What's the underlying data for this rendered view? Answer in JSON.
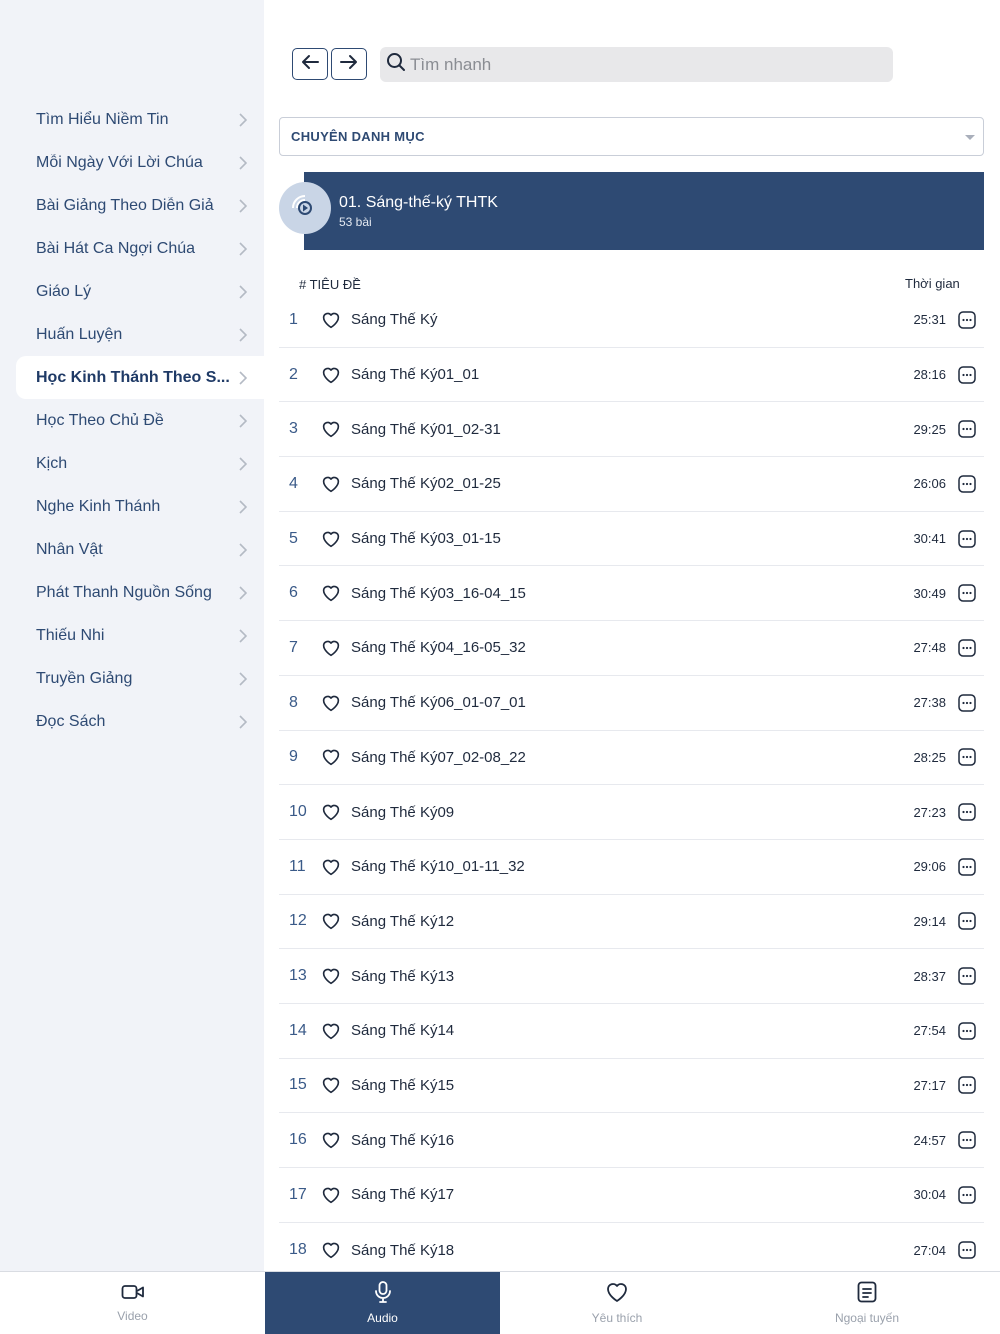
{
  "sidebar": {
    "items": [
      {
        "label": "Tìm Hiểu Niềm Tin",
        "active": false
      },
      {
        "label": "Mỗi Ngày Với Lời Chúa",
        "active": false
      },
      {
        "label": "Bài Giảng Theo Diễn Giả",
        "active": false
      },
      {
        "label": "Bài Hát Ca Ngợi Chúa",
        "active": false
      },
      {
        "label": "Giáo Lý",
        "active": false
      },
      {
        "label": "Huấn Luyện",
        "active": false
      },
      {
        "label": "Học Kinh Thánh Theo S...",
        "active": true
      },
      {
        "label": "Học Theo Chủ Đề",
        "active": false
      },
      {
        "label": "Kịch",
        "active": false
      },
      {
        "label": "Nghe Kinh Thánh",
        "active": false
      },
      {
        "label": "Nhân Vật",
        "active": false
      },
      {
        "label": "Phát Thanh Nguồn Sống",
        "active": false
      },
      {
        "label": "Thiếu Nhi",
        "active": false
      },
      {
        "label": "Truyền Giảng",
        "active": false
      },
      {
        "label": "Đọc Sách",
        "active": false
      }
    ]
  },
  "header": {
    "search_placeholder": "Tìm nhanh"
  },
  "category_select": {
    "label": "CHUYÊN DANH MỤC"
  },
  "playlist": {
    "title": "01. Sáng-thế-ký THTK",
    "count": "53 bài"
  },
  "columns": {
    "title": "# TIÊU ĐỀ",
    "duration": "Thời gian"
  },
  "tracks": [
    {
      "num": "1",
      "title": "Sáng Thế Ký",
      "duration": "25:31"
    },
    {
      "num": "2",
      "title": "Sáng Thế Ký01_01",
      "duration": "28:16"
    },
    {
      "num": "3",
      "title": "Sáng Thế Ký01_02-31",
      "duration": "29:25"
    },
    {
      "num": "4",
      "title": "Sáng Thế Ký02_01-25",
      "duration": "26:06"
    },
    {
      "num": "5",
      "title": "Sáng Thế Ký03_01-15",
      "duration": "30:41"
    },
    {
      "num": "6",
      "title": "Sáng Thế Ký03_16-04_15",
      "duration": "30:49"
    },
    {
      "num": "7",
      "title": "Sáng Thế Ký04_16-05_32",
      "duration": "27:48"
    },
    {
      "num": "8",
      "title": "Sáng Thế Ký06_01-07_01",
      "duration": "27:38"
    },
    {
      "num": "9",
      "title": "Sáng Thế Ký07_02-08_22",
      "duration": "28:25"
    },
    {
      "num": "10",
      "title": "Sáng Thế Ký09",
      "duration": "27:23"
    },
    {
      "num": "11",
      "title": "Sáng Thế Ký10_01-11_32",
      "duration": "29:06"
    },
    {
      "num": "12",
      "title": "Sáng Thế Ký12",
      "duration": "29:14"
    },
    {
      "num": "13",
      "title": "Sáng Thế Ký13",
      "duration": "28:37"
    },
    {
      "num": "14",
      "title": "Sáng Thế Ký14",
      "duration": "27:54"
    },
    {
      "num": "15",
      "title": "Sáng Thế Ký15",
      "duration": "27:17"
    },
    {
      "num": "16",
      "title": "Sáng Thế Ký16",
      "duration": "24:57"
    },
    {
      "num": "17",
      "title": "Sáng Thế Ký17",
      "duration": "30:04"
    },
    {
      "num": "18",
      "title": "Sáng Thế Ký18",
      "duration": "27:04"
    }
  ],
  "tabs": [
    {
      "label": "Video",
      "icon": "video-camera-icon",
      "active": false
    },
    {
      "label": "Audio",
      "icon": "microphone-icon",
      "active": true
    },
    {
      "label": "Yêu thích",
      "icon": "heart-icon",
      "active": false
    },
    {
      "label": "Ngoại tuyến",
      "icon": "document-icon",
      "active": false
    }
  ],
  "colors": {
    "primary": "#2e4a73",
    "sidebar_bg": "#f1f3f8",
    "search_bg": "#e8e8ea",
    "disc": "#c9d5e6"
  }
}
